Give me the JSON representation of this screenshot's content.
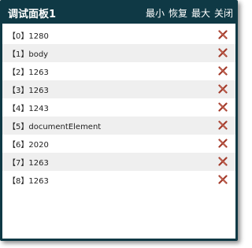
{
  "panel": {
    "title": "调试面板1",
    "controls": {
      "minimize": "最小",
      "restore": "恢复",
      "maximize": "最大",
      "close": "关闭"
    }
  },
  "items": [
    {
      "label": "【0】1280"
    },
    {
      "label": "【1】body"
    },
    {
      "label": "【2】1263"
    },
    {
      "label": "【3】1263"
    },
    {
      "label": "【4】1243"
    },
    {
      "label": "【5】documentElement"
    },
    {
      "label": "【6】2020"
    },
    {
      "label": "【7】1263"
    },
    {
      "label": "【8】1263"
    }
  ],
  "icons": {
    "delete": "delete-x-icon"
  },
  "colors": {
    "titlebar": "#0f3945",
    "stripe": "#efefef",
    "delete_icon": "#a33a2a"
  }
}
